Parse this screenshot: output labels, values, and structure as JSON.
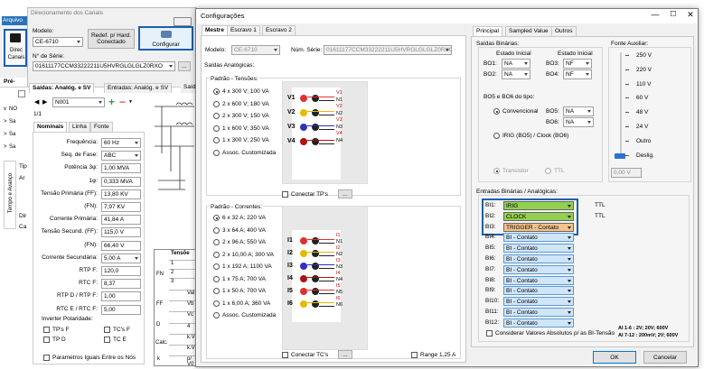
{
  "main_window": {
    "menu_file": "Arquivo",
    "title": "Direcionamento dos Canais",
    "direc_label_1": "Direc",
    "direc_label_2": "Canais",
    "model_label": "Modelo:",
    "model_value": "CE-6710",
    "redef_btn": "Redef. p/ Hard. Conectado",
    "config_btn": "Configurar",
    "serial_label": "N° de Série:",
    "serial_value": "01611177CCM33222211U5HVRGLGLGLZ0RXO",
    "pre_label": "Pré-",
    "tab_saidas": "Saídas: Analóg. e SV",
    "tab_entradas": "Entradas: Analóg. e SV",
    "tab_said_short": "Saíd",
    "side_rows": [
      "NO",
      "Sa",
      "Sa",
      "Sa"
    ],
    "node_value": "N001",
    "page": "1/1",
    "sub_tabs": [
      "Nominais",
      "Linha",
      "Fonte"
    ],
    "fields": [
      {
        "label": "Frequência:",
        "value": "60 Hz",
        "dd": true
      },
      {
        "label": "Seq. de Fase:",
        "value": "ABC",
        "dd": true
      },
      {
        "label": "Potência 3φ:",
        "value": "1,00 MVA",
        "dd": false
      },
      {
        "label": "1φ:",
        "value": "0,333 MVA",
        "dd": false
      },
      {
        "label": "Tensão Primária (FF):",
        "value": "13,80 KV",
        "dd": false
      },
      {
        "label": "(FN):",
        "value": "7,97 KV",
        "dd": false
      },
      {
        "label": "Corrente Primária:",
        "value": "41,84 A",
        "dd": false
      },
      {
        "label": "Tensão Secund. (FF):",
        "value": "115,0 V",
        "dd": false
      },
      {
        "label": "(FN):",
        "value": "66,40 V",
        "dd": false
      },
      {
        "label": "Corrente Secundária:",
        "value": "5,00 A",
        "dd": true
      },
      {
        "label": "RTP F:",
        "value": "120,0",
        "dd": false
      },
      {
        "label": "RTC F:",
        "value": "8,37",
        "dd": false
      },
      {
        "label": "RTP D / RTP F:",
        "value": "1,00",
        "dd": false
      },
      {
        "label": "RTC E / RTC F:",
        "value": "5,00",
        "dd": false
      }
    ],
    "inverter_label": "Inverter Polaridade:",
    "inv_tps_f": "TP's F",
    "inv_tcs_f": "TC's F",
    "inv_tp_d": "TP D",
    "inv_tc_e": "TC E",
    "param_label": "Parametros Iguais Entre os Nós",
    "side_tip": "Tip",
    "side_ar": "Ar",
    "vert_label": "Tempo e Avanço",
    "tensoes_title": "Tensõe",
    "tensoes_rows": [
      "1",
      "2",
      "3",
      "Val",
      "Vb",
      "Vc",
      "4",
      "k.V",
      "k.V",
      "p/ V0"
    ],
    "tensoes_left": [
      "FN",
      "FF",
      "D",
      "Calc.",
      "k"
    ],
    "tensoes_one": "1"
  },
  "dialog": {
    "title": "Configurações",
    "tabs": [
      "Mestre",
      "Escravo 1",
      "Escravo 2"
    ],
    "model_label": "Modelo:",
    "model_value": "CE-6710",
    "serial_label": "Núm. Série:",
    "serial_value": "01611177CCM33222211U5HVRGLGLGLZ0RXO",
    "saidas_title": "Saídas Analógicas:",
    "tensoes_title": "Padrão - Tensões:",
    "tensoes_options": [
      "4 x 300 V; 100 VA",
      "2 x 600 V; 180 VA",
      "2 x 300 V; 150 VA",
      "1 x 600 V; 350 VA",
      "1 x 300 V; 250 VA",
      "Assoc. Customizada"
    ],
    "correntes_title": "Padrão - Correntes:",
    "correntes_options": [
      "6 x 32 A; 220 VA",
      "3 x 64 A; 400 VA",
      "2 x 96 A; 550 VA",
      "2 x 10,00 A; 300 VA",
      "1 x 192 A; 1100 VA",
      "1 x 75 A; 700 VA",
      "1 x 50 A; 700 VA",
      "1 x 6,00 A; 360 VA",
      "Assoc. Customizada"
    ],
    "v_labels": [
      "V1",
      "V2",
      "V3",
      "V4"
    ],
    "v_right": [
      "V1",
      "N1",
      "V2",
      "N2",
      "V3",
      "N3",
      "V4",
      "N4"
    ],
    "i_labels": [
      "I1",
      "I2",
      "I3",
      "I4",
      "I5",
      "I6"
    ],
    "i_right": [
      "I1",
      "N1",
      "I2",
      "N2",
      "I3",
      "N3",
      "I4",
      "N4",
      "I5",
      "N5",
      "I6",
      "N6"
    ],
    "conectar_tps": "Conectar TP's",
    "conectar_tcs": "Conectar TC's",
    "range_label": "Range 1,25 A",
    "right_tabs": [
      "Principal",
      "Sampled Value",
      "Outros"
    ],
    "saidas_bin": "Saídas Binárias:",
    "estado_inicial": "Estado Inicial",
    "bo": [
      {
        "l": "BO1:",
        "v": "NA"
      },
      {
        "l": "BO2:",
        "v": "NA"
      },
      {
        "l": "BO3:",
        "v": "NF"
      },
      {
        "l": "BO4:",
        "v": "NF"
      }
    ],
    "bo56_title": "BO5 e BO6 do tipo:",
    "convencional": "Convencional",
    "bo5": "BO5:",
    "bo6": "BO6:",
    "bo56_value": "NA",
    "irig": "IRIG (BO5) / Clock (BO6)",
    "transistor": "Transistor",
    "ttl": "TTL",
    "fonte_aux": "Fonte Auxiliar:",
    "fonte_scale": [
      "250 V",
      "220 V",
      "110 V",
      "60 V",
      "48 V",
      "24 V",
      "Outro",
      "Deslig."
    ],
    "fonte_value": "0,00 V",
    "entradas_title": "Entradas Binárias / Analógicas:",
    "bi_items": [
      {
        "l": "BI1:",
        "v": "IRIG",
        "t": "TTL"
      },
      {
        "l": "BI2:",
        "v": "CLOCK",
        "t": "TTL"
      },
      {
        "l": "BI3:",
        "v": "TRIGGER - Contato",
        "t": ""
      },
      {
        "l": "BI4:",
        "v": "BI - Contato",
        "t": ""
      },
      {
        "l": "BI5:",
        "v": "BI - Contato",
        "t": ""
      },
      {
        "l": "BI6:",
        "v": "BI - Contato",
        "t": ""
      },
      {
        "l": "BI7:",
        "v": "BI - Contato",
        "t": ""
      },
      {
        "l": "BI8:",
        "v": "BI - Contato",
        "t": ""
      },
      {
        "l": "BI9:",
        "v": "BI - Contato",
        "t": ""
      },
      {
        "l": "BI10:",
        "v": "BI - Contato",
        "t": ""
      },
      {
        "l": "BI11:",
        "v": "BI - Contato",
        "t": ""
      },
      {
        "l": "BI12:",
        "v": "BI - Contato",
        "t": ""
      }
    ],
    "considerar": "Considerar Valores Absolutos p/ as BI-Tensão",
    "ai_note_1": "AI 1-6 : 2V; 20V; 600V",
    "ai_note_2": "AI 7-12 : 200mV; 2V; 600V",
    "ok": "OK",
    "cancel": "Cancelar"
  },
  "colors": {
    "highlight": "#1f5faa",
    "green": "#92d050",
    "orange": "#f4c28a",
    "bi_blue": "#cfe5f8"
  }
}
